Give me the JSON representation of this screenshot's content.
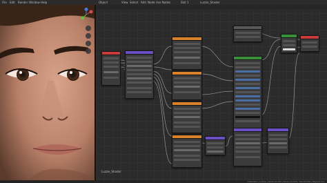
{
  "header": {
    "menu_items": [
      "File",
      "Edit",
      "Render",
      "Window",
      "Help"
    ],
    "viewport_menus": [
      "Object",
      "View",
      "Select",
      "Add",
      "Node",
      "Use Nodes"
    ],
    "slot_label": "Slot 1",
    "material_name": "Luzzie_Shader"
  },
  "frame": {
    "label": "Luzzie_Shader"
  },
  "status": {
    "text": "Collection | Luzzie | Verts:12,753 | Faces:12,753 | Tris:25,506 | Objects:1/1"
  },
  "colors": {
    "principled": "#4a9b52",
    "texture": "#d9822b",
    "math": "#7a5fc4",
    "output": "#c93a3a",
    "bsdf_green": "#3a8f3a"
  },
  "icons": [
    "gizmo-x",
    "gizmo-y",
    "gizmo-z",
    "zoom-icon",
    "hand-icon",
    "camera-icon",
    "grid-icon"
  ]
}
